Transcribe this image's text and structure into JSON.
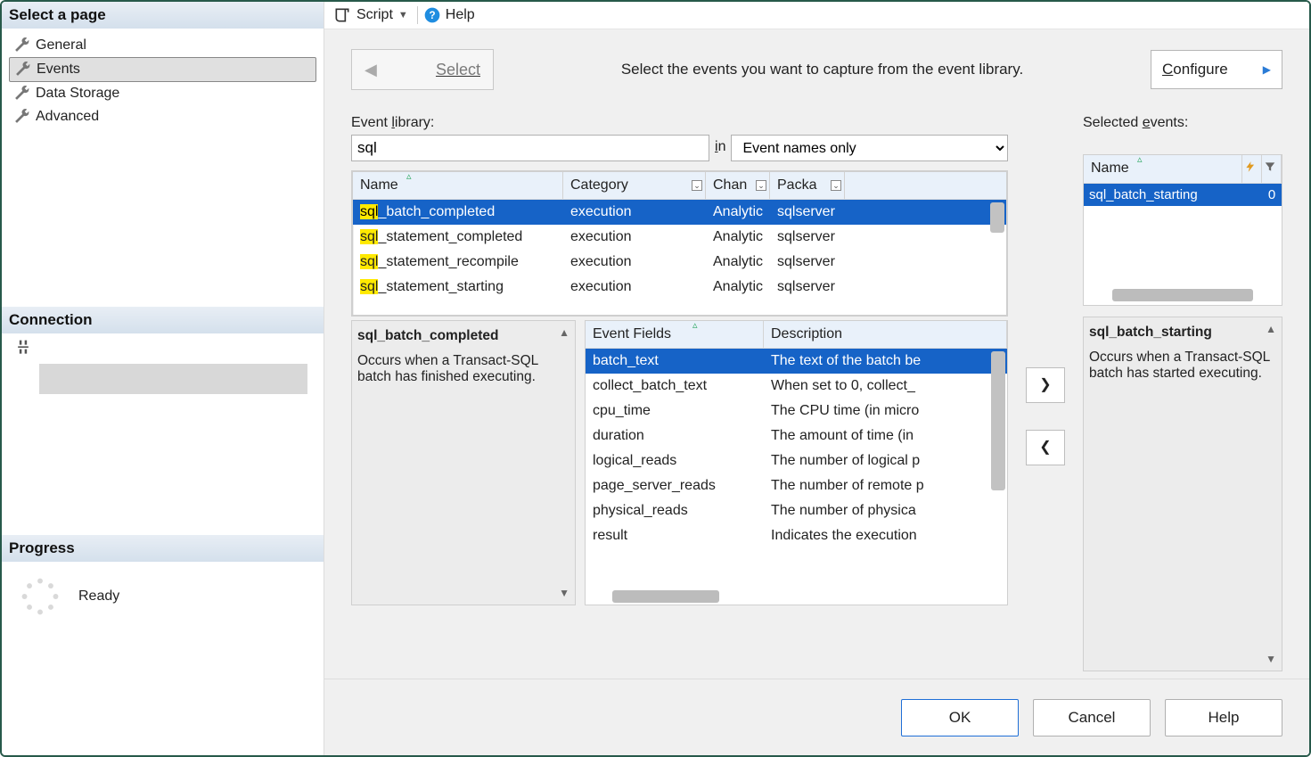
{
  "sidebar": {
    "title": "Select a page",
    "items": [
      {
        "label": "General"
      },
      {
        "label": "Events",
        "selected": true
      },
      {
        "label": "Data Storage"
      },
      {
        "label": "Advanced"
      }
    ],
    "connection_title": "Connection",
    "progress_title": "Progress",
    "progress_status": "Ready"
  },
  "toolbar": {
    "script_label": "Script",
    "help_label": "Help"
  },
  "page": {
    "select_word": "Select",
    "description": "Select the events you want to capture from the event library.",
    "configure_label": "Configure",
    "lib_label": "Event library:",
    "search_value": "sql",
    "in_word": "in",
    "search_scope": "Event names only",
    "selected_label": "Selected events:"
  },
  "lib_grid": {
    "headers": {
      "name": "Name",
      "category": "Category",
      "channel": "Chan",
      "package": "Packa"
    },
    "rows": [
      {
        "name_hl": "sql",
        "name_rest": "_batch_completed",
        "category": "execution",
        "channel": "Analytic",
        "package": "sqlserver",
        "selected": true
      },
      {
        "name_hl": "sql",
        "name_rest": "_statement_completed",
        "category": "execution",
        "channel": "Analytic",
        "package": "sqlserver"
      },
      {
        "name_hl": "sql",
        "name_rest": "_statement_recompile",
        "category": "execution",
        "channel": "Analytic",
        "package": "sqlserver"
      },
      {
        "name_hl": "sql",
        "name_rest": "_statement_starting",
        "category": "execution",
        "channel": "Analytic",
        "package": "sqlserver"
      }
    ]
  },
  "event_desc": {
    "title": "sql_batch_completed",
    "text": "Occurs when a Transact-SQL batch has finished executing."
  },
  "fields_grid": {
    "headers": {
      "field": "Event Fields",
      "desc": "Description"
    },
    "rows": [
      {
        "field": "batch_text",
        "desc": "The text of the batch be",
        "selected": true
      },
      {
        "field": "collect_batch_text",
        "desc": "When set to 0, collect_"
      },
      {
        "field": "cpu_time",
        "desc": "The CPU time (in micro"
      },
      {
        "field": "duration",
        "desc": "The amount of time (in "
      },
      {
        "field": "logical_reads",
        "desc": "The number of logical p"
      },
      {
        "field": "page_server_reads",
        "desc": "The number of remote p"
      },
      {
        "field": "physical_reads",
        "desc": "The number of physica"
      },
      {
        "field": "result",
        "desc": "Indicates the execution"
      }
    ]
  },
  "selected_grid": {
    "headers": {
      "name": "Name"
    },
    "rows": [
      {
        "name": "sql_batch_starting",
        "count": "0"
      }
    ]
  },
  "selected_desc": {
    "title": "sql_batch_starting",
    "text": "Occurs when a Transact-SQL batch has started executing."
  },
  "buttons": {
    "ok": "OK",
    "cancel": "Cancel",
    "help": "Help"
  },
  "move": {
    "right": "❯",
    "left": "❮"
  }
}
